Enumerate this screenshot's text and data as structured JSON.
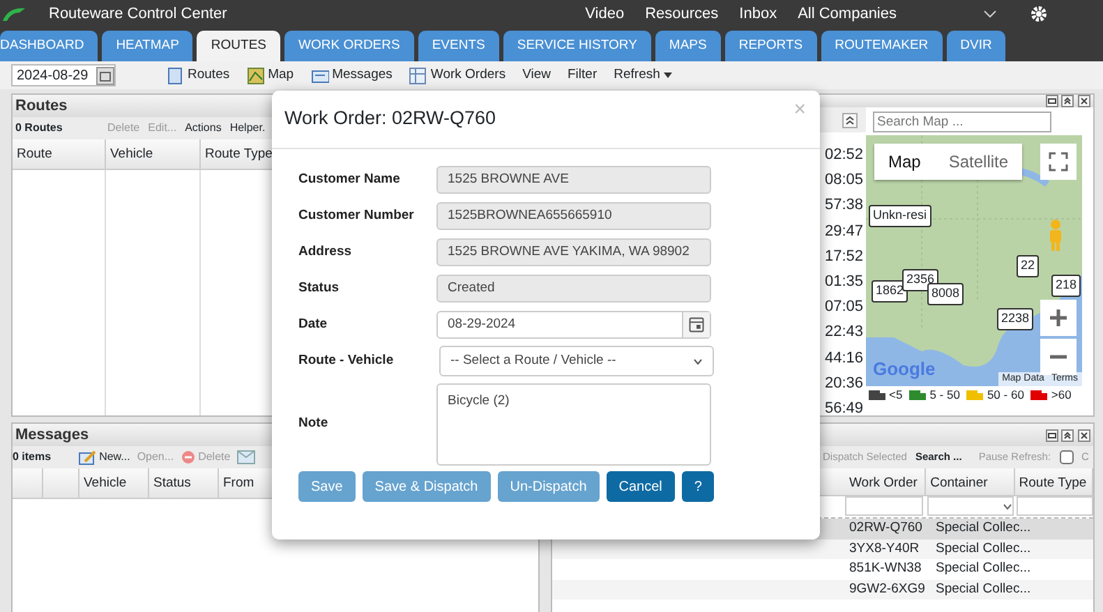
{
  "app": {
    "title": "Routeware Control Center",
    "links": [
      "Video",
      "Resources",
      "Inbox"
    ],
    "company": "All Companies"
  },
  "tabs": [
    {
      "label": "DASHBOARD",
      "selected": false
    },
    {
      "label": "HEATMAP",
      "selected": false
    },
    {
      "label": "ROUTES",
      "selected": true
    },
    {
      "label": "WORK ORDERS",
      "selected": false
    },
    {
      "label": "EVENTS",
      "selected": false
    },
    {
      "label": "SERVICE HISTORY",
      "selected": false
    },
    {
      "label": "MAPS",
      "selected": false
    },
    {
      "label": "REPORTS",
      "selected": false
    },
    {
      "label": "ROUTEMAKER",
      "selected": false
    },
    {
      "label": "DVIR",
      "selected": false
    }
  ],
  "toolbar": {
    "date": "2024-08-29",
    "items": [
      {
        "label": "Routes",
        "kind": "routes"
      },
      {
        "label": "Map",
        "kind": "map"
      },
      {
        "label": "Messages",
        "kind": "messages"
      },
      {
        "label": "Work Orders",
        "kind": "orders"
      },
      {
        "label": "View",
        "kind": "plain"
      },
      {
        "label": "Filter",
        "kind": "plain"
      },
      {
        "label": "Refresh",
        "kind": "menu"
      }
    ]
  },
  "routes_panel": {
    "title": "Routes",
    "count": "0 Routes",
    "actions": [
      {
        "label": "Delete",
        "disabled": true
      },
      {
        "label": "Edit...",
        "disabled": true
      },
      {
        "label": "Actions",
        "disabled": false
      },
      {
        "label": "Helper.",
        "disabled": false
      }
    ],
    "columns": [
      "Route",
      "Vehicle",
      "Route Type"
    ]
  },
  "times_panel": {
    "times": [
      "02:52",
      "08:05",
      "57:38",
      "29:47",
      "17:52",
      "01:35",
      "07:05",
      "22:43",
      "44:16",
      "20:36",
      "56:49"
    ]
  },
  "map": {
    "search_placeholder": "Search Map ...",
    "map_types": [
      {
        "label": "Map",
        "selected": true
      },
      {
        "label": "Satellite",
        "selected": false
      }
    ],
    "markers": [
      {
        "label": "Unkn-resi"
      },
      {
        "label": "1862"
      },
      {
        "label": "2356"
      },
      {
        "label": "8008"
      },
      {
        "label": "2238"
      },
      {
        "label": "22"
      },
      {
        "label": "218"
      }
    ],
    "logo": "Google",
    "attribution": [
      "Map Data",
      "Terms"
    ],
    "legend": [
      {
        "label": "<5",
        "color": "#444444"
      },
      {
        "label": "5 - 50",
        "color": "#2e8b2e"
      },
      {
        "label": "50 - 60",
        "color": "#f0c000"
      },
      {
        "label": ">60",
        "color": "#e00000"
      }
    ]
  },
  "messages_panel": {
    "title": "Messages",
    "count": "0 items",
    "actions": [
      {
        "label": "New...",
        "kind": "new",
        "disabled": false
      },
      {
        "label": "Open...",
        "kind": "plain",
        "disabled": true
      },
      {
        "label": "Delete",
        "kind": "delete",
        "disabled": true
      }
    ],
    "columns": [
      "Vehicle",
      "Status",
      "From"
    ]
  },
  "orders_panel": {
    "actions": [
      {
        "label": "Dispatch Selected",
        "disabled": true
      },
      {
        "label": "Search ...",
        "disabled": false
      }
    ],
    "pause_label": "Pause Refresh:",
    "pause_checked": false,
    "cut_label": "C",
    "columns": [
      "Work Order",
      "Container",
      "Route Type"
    ],
    "rows": [
      {
        "cells": [
          "02RW-Q760",
          "Special Collec..."
        ],
        "selected": true
      },
      {
        "cells": [
          "3YX8-Y40R",
          "Special Collec..."
        ],
        "selected": false
      },
      {
        "cells": [
          "851K-WN38",
          "Special Collec..."
        ],
        "selected": false
      },
      {
        "cells": [
          "9GW2-6XG9",
          "Special Collec..."
        ],
        "selected": false
      }
    ]
  },
  "modal": {
    "title": "Work Order: 02RW-Q760",
    "close": "×",
    "fields": [
      {
        "label": "Customer Name",
        "kind": "readonly",
        "value": "1525 BROWNE AVE"
      },
      {
        "label": "Customer Number",
        "kind": "readonly",
        "value": "1525BROWNEA655665910"
      },
      {
        "label": "Address",
        "kind": "readonly",
        "value": "1525 BROWNE AVE YAKIMA, WA 98902"
      },
      {
        "label": "Status",
        "kind": "readonly",
        "value": "Created"
      },
      {
        "label": "Date",
        "kind": "date",
        "value": "08-29-2024"
      },
      {
        "label": "Route - Vehicle",
        "kind": "select",
        "value": "-- Select a Route / Vehicle --"
      },
      {
        "label": "Note",
        "kind": "textarea",
        "value": "Bicycle (2)"
      }
    ],
    "buttons": [
      {
        "label": "Save",
        "disabled": true
      },
      {
        "label": "Save & Dispatch",
        "disabled": true
      },
      {
        "label": "Un-Dispatch",
        "disabled": true
      },
      {
        "label": "Cancel",
        "disabled": false
      },
      {
        "label": "?",
        "disabled": false
      }
    ]
  }
}
